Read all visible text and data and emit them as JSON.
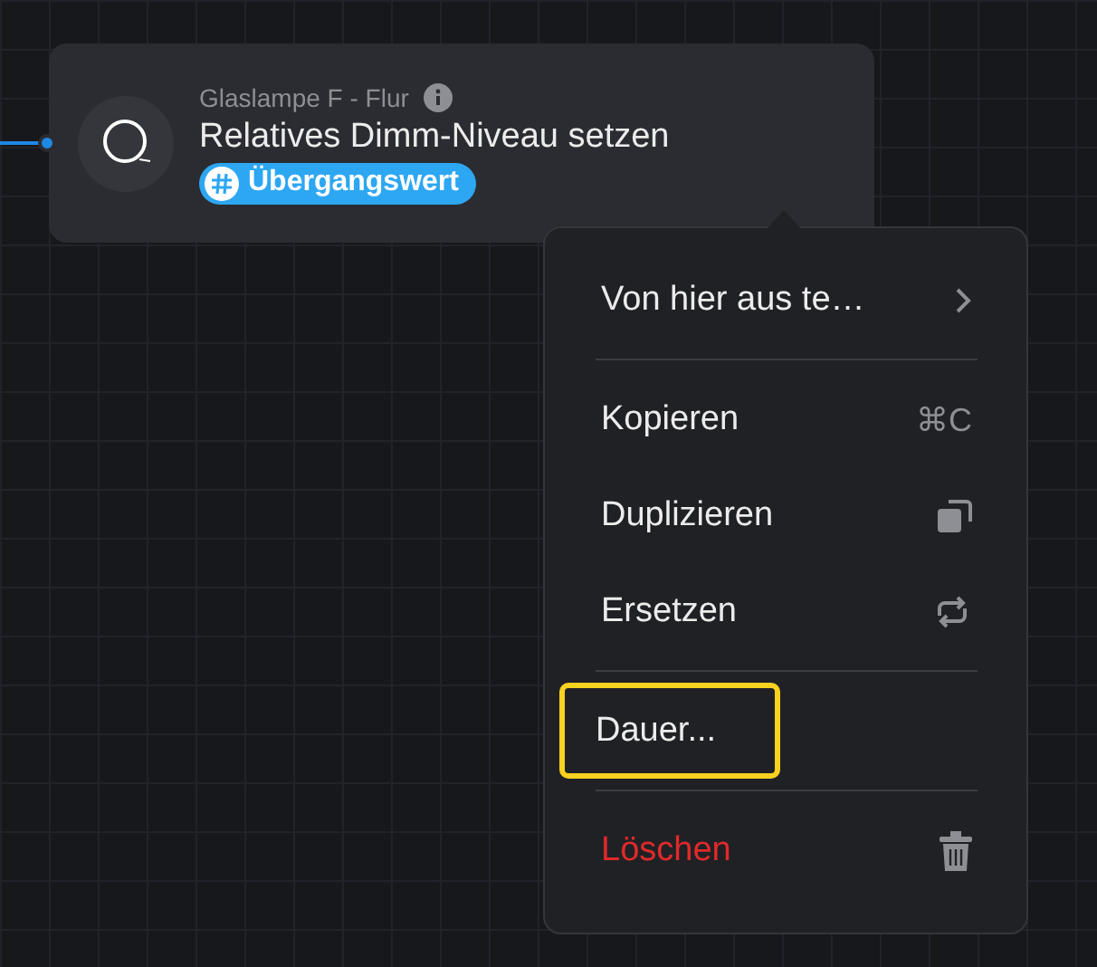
{
  "node": {
    "device": "Glaslampe F - Flur",
    "action": "Relatives Dimm-Niveau setzen",
    "tag": "Übergangswert"
  },
  "menu": {
    "groups": [
      {
        "items": [
          {
            "kind": "submenu",
            "label": "Von hier aus te…",
            "focused": false
          }
        ]
      },
      {
        "items": [
          {
            "kind": "shortcut",
            "label": "Kopieren",
            "shortcut": "⌘C",
            "focused": false
          },
          {
            "kind": "duplicate",
            "label": "Duplizieren",
            "focused": false
          },
          {
            "kind": "replace",
            "label": "Ersetzen",
            "focused": false
          }
        ]
      },
      {
        "items": [
          {
            "kind": "plain",
            "label": "Dauer...",
            "focused": true
          }
        ]
      },
      {
        "items": [
          {
            "kind": "delete",
            "label": "Löschen",
            "focused": false
          }
        ]
      }
    ]
  }
}
